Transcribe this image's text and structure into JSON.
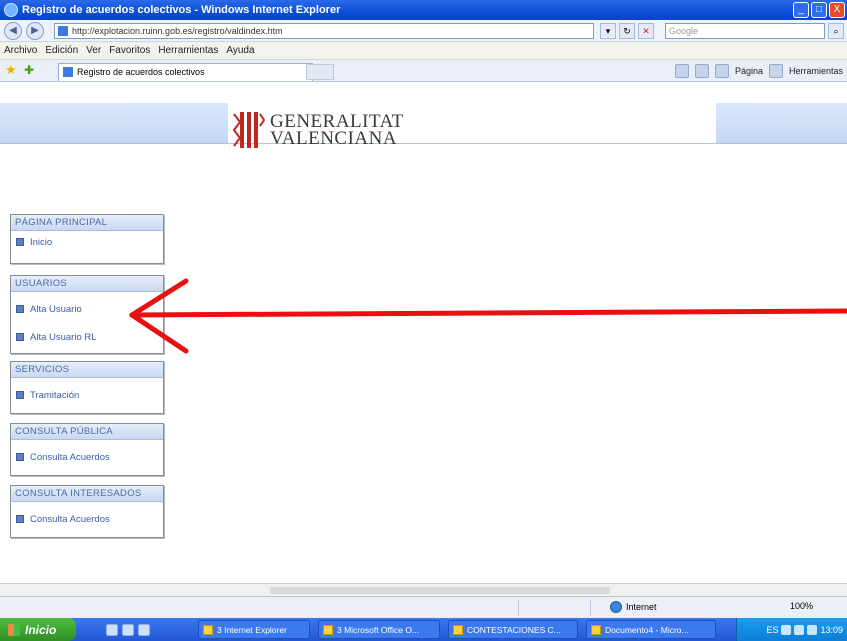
{
  "window": {
    "title": "Registro de acuerdos colectivos - Windows Internet Explorer",
    "buttons": [
      "_",
      "□",
      "X"
    ]
  },
  "address_bar": {
    "url": "http://explotacion.ruinn.gob.es/registro/valdindex.htm",
    "search_placeholder": "Google"
  },
  "menu_bar": {
    "items": [
      "Archivo",
      "Edición",
      "Ver",
      "Favoritos",
      "Herramientas",
      "Ayuda"
    ]
  },
  "tab_bar": {
    "tab_title": "Registro de acuerdos colectivos",
    "commands": [
      "Página",
      "Herramientas"
    ]
  },
  "page": {
    "logo": {
      "line1": "GENERALITAT",
      "line2": "VALENCIANA"
    },
    "menu_boxes": [
      {
        "header": "PÁGINA PRINCIPAL",
        "items": [
          "Inicio"
        ]
      },
      {
        "header": "USUARIOS",
        "items": [
          "Alta Usuario",
          "Alta Usuario RL"
        ]
      },
      {
        "header": "SERVICIOS",
        "items": [
          "Tramitación"
        ]
      },
      {
        "header": "CONSULTA PÚBLICA",
        "items": [
          "Consulta Acuerdos"
        ]
      },
      {
        "header": "CONSULTA INTERESADOS",
        "items": [
          "Consulta Acuerdos"
        ]
      }
    ]
  },
  "status_bar": {
    "zone": "Internet",
    "zoom": "100%"
  },
  "taskbar": {
    "start_label": "Inicio",
    "buttons": [
      "3 Internet Explorer",
      "3 Microsoft Office O...",
      "CONTESTACIONES C...",
      "Documento4 - Micro..."
    ],
    "clock": "13:09",
    "language": "ES"
  },
  "colors": {
    "annotation_arrow": "#e81010",
    "menu_header_text": "#4a6aa6",
    "link_text": "#3a5fa0"
  }
}
